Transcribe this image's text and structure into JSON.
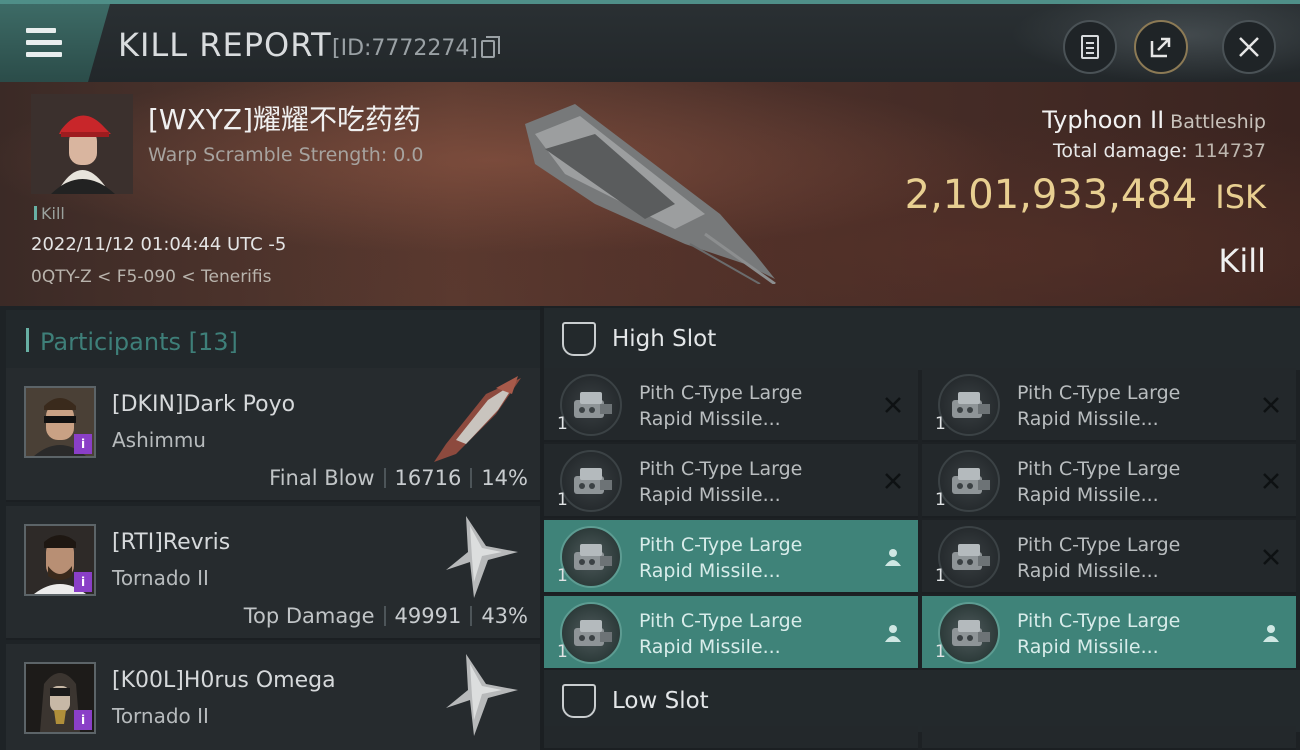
{
  "header": {
    "title": "KILL REPORT",
    "report_id": "[ID:7772274]"
  },
  "victim": {
    "name": "[WXYZ]耀耀不吃药药",
    "warp_scramble": "Warp Scramble Strength: 0.0",
    "tag": "Kill",
    "datetime": "2022/11/12 01:04:44 UTC -5",
    "location": "0QTY-Z < F5-090 < Tenerifis",
    "ship_name": "Typhoon II",
    "ship_class": "Battleship",
    "total_damage_label": "Total damage:",
    "total_damage": "114737",
    "isk_value": "2,101,933,484",
    "isk_unit": "ISK",
    "result": "Kill"
  },
  "participants": {
    "title": "Participants",
    "count": "[13]",
    "rows": [
      {
        "name": "[DKIN]Dark Poyo",
        "ship": "Ashimmu",
        "label": "Final Blow",
        "damage": "16716",
        "percent": "14%"
      },
      {
        "name": "[RTI]Revris",
        "ship": "Tornado II",
        "label": "Top Damage",
        "damage": "49991",
        "percent": "43%"
      },
      {
        "name": "[K00L]H0rus Omega",
        "ship": "Tornado II",
        "label": "",
        "damage": "",
        "percent": ""
      }
    ]
  },
  "fitting": {
    "high_slot_title": "High Slot",
    "low_slot_title": "Low Slot",
    "modules": [
      {
        "qty": "1",
        "line1": "Pith C-Type Large",
        "line2": "Rapid Missile...",
        "status": "destroyed"
      },
      {
        "qty": "1",
        "line1": "Pith C-Type Large",
        "line2": "Rapid Missile...",
        "status": "destroyed"
      },
      {
        "qty": "1",
        "line1": "Pith C-Type Large",
        "line2": "Rapid Missile...",
        "status": "destroyed"
      },
      {
        "qty": "1",
        "line1": "Pith C-Type Large",
        "line2": "Rapid Missile...",
        "status": "destroyed"
      },
      {
        "qty": "1",
        "line1": "Pith C-Type Large",
        "line2": "Rapid Missile...",
        "status": "dropped"
      },
      {
        "qty": "1",
        "line1": "Pith C-Type Large",
        "line2": "Rapid Missile...",
        "status": "destroyed"
      },
      {
        "qty": "1",
        "line1": "Pith C-Type Large",
        "line2": "Rapid Missile...",
        "status": "dropped"
      },
      {
        "qty": "1",
        "line1": "Pith C-Type Large",
        "line2": "Rapid Missile...",
        "status": "dropped"
      }
    ]
  },
  "icons": {
    "menu": "menu-icon",
    "copy": "copy-icon",
    "clipboard": "clipboard-icon",
    "share": "share-icon",
    "close": "close-icon",
    "destroyed": "x-icon",
    "dropped": "person-icon",
    "slot": "slot-icon"
  },
  "colors": {
    "accent": "#68b0a4",
    "isk": "#e8cf91",
    "dropped_bg": "#3f8379",
    "security_badge": "#8a3fc7"
  }
}
